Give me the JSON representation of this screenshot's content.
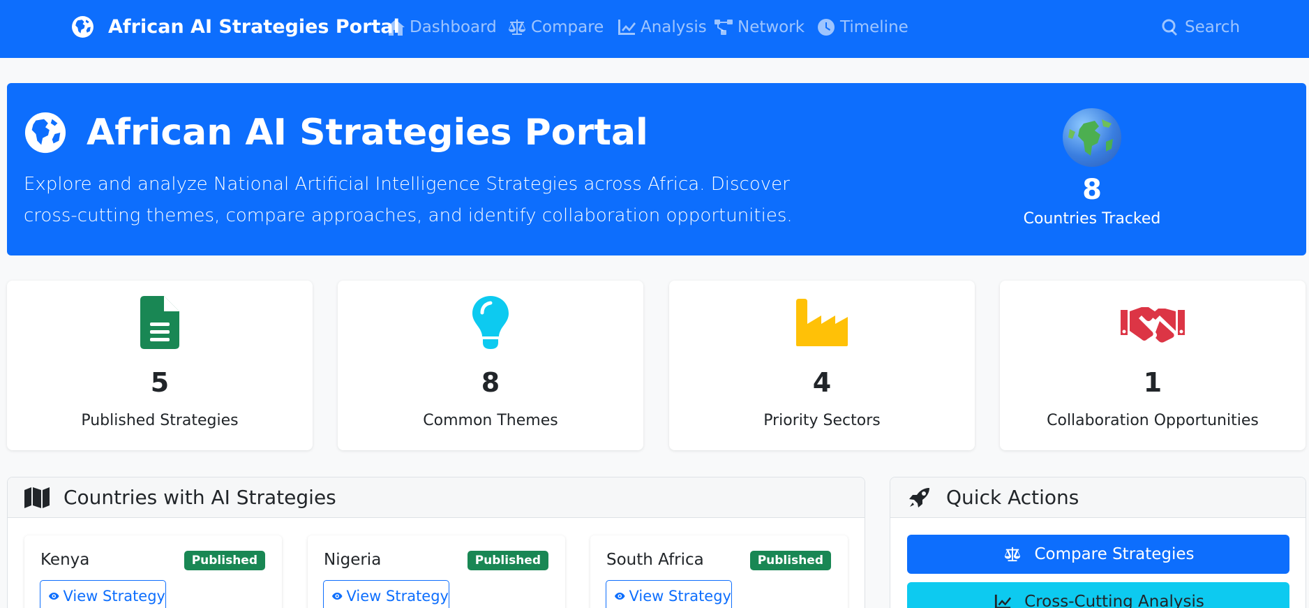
{
  "navbar": {
    "brand": "African AI Strategies Portal",
    "links": [
      {
        "label": "Dashboard",
        "icon": "home-icon"
      },
      {
        "label": "Compare",
        "icon": "balance-scale-icon"
      },
      {
        "label": "Analysis",
        "icon": "line-chart-icon"
      },
      {
        "label": "Network",
        "icon": "network-icon"
      },
      {
        "label": "Timeline",
        "icon": "clock-icon"
      }
    ],
    "search_label": "Search"
  },
  "hero": {
    "title": "African AI Strategies Portal",
    "description": "Explore and analyze National Artificial Intelligence Strategies across Africa. Discover cross-cutting themes, compare approaches, and identify collaboration opportunities.",
    "stat_value": "8",
    "stat_label": "Countries Tracked"
  },
  "stats": [
    {
      "value": "5",
      "label": "Published Strategies",
      "icon": "document-icon",
      "color": "#198754"
    },
    {
      "value": "8",
      "label": "Common Themes",
      "icon": "lightbulb-icon",
      "color": "#0dcaf0"
    },
    {
      "value": "4",
      "label": "Priority Sectors",
      "icon": "industry-icon",
      "color": "#ffc107"
    },
    {
      "value": "1",
      "label": "Collaboration Opportunities",
      "icon": "handshake-icon",
      "color": "#dc3545"
    }
  ],
  "countries_panel": {
    "title": "Countries with AI Strategies",
    "countries": [
      {
        "name": "Kenya",
        "status": "Published",
        "action": "View Strategy"
      },
      {
        "name": "Nigeria",
        "status": "Published",
        "action": "View Strategy"
      },
      {
        "name": "South Africa",
        "status": "Published",
        "action": "View Strategy"
      }
    ]
  },
  "quick_actions": {
    "title": "Quick Actions",
    "buttons": [
      {
        "label": "Compare Strategies",
        "color": "#0d6efd"
      },
      {
        "label": "Cross-Cutting Analysis",
        "color": "#0dcaf0"
      }
    ]
  },
  "colors": {
    "primary": "#0d6efd",
    "success": "#198754",
    "info": "#0dcaf0",
    "warning": "#ffc107",
    "danger": "#dc3545"
  }
}
